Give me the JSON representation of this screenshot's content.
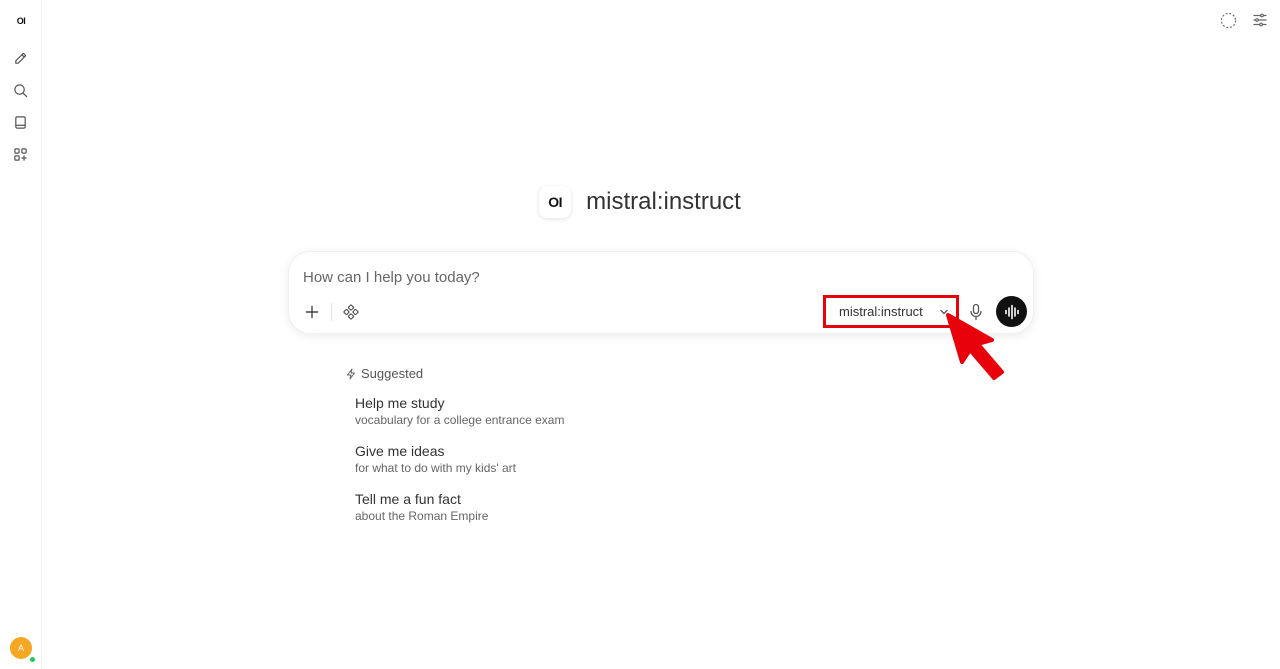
{
  "sidebar": {
    "logo": "OI",
    "icons": [
      "new-chat-icon",
      "search-icon",
      "notes-icon",
      "workspace-icon"
    ],
    "user_initial": "A"
  },
  "header_icons": [
    "controls-icon",
    "settings-sliders-icon"
  ],
  "main": {
    "model_logo": "OI",
    "model_name": "mistral:instruct"
  },
  "chat_input": {
    "placeholder": "How can I help you today?",
    "value": "",
    "model_selector_label": "mistral:instruct"
  },
  "suggested": {
    "label": "Suggested",
    "items": [
      {
        "title": "Help me study",
        "subtitle": "vocabulary for a college entrance exam"
      },
      {
        "title": "Give me ideas",
        "subtitle": "for what to do with my kids' art"
      },
      {
        "title": "Tell me a fun fact",
        "subtitle": "about the Roman Empire"
      }
    ]
  },
  "colors": {
    "highlight_red": "#e8000b",
    "avatar": "#f5a623",
    "status_online": "#22c55e"
  }
}
